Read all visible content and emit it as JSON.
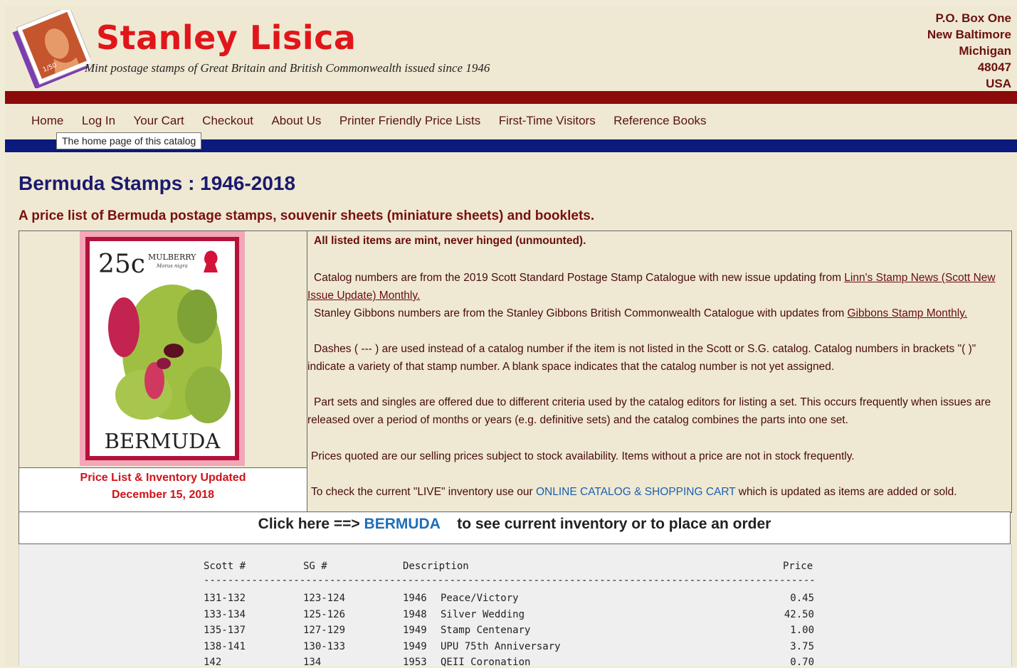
{
  "header": {
    "title": "Stanley Lisica",
    "tagline": "Mint postage stamps of Great Britain and British Commonwealth issued since 1946",
    "address": [
      "P.O. Box One",
      "New Baltimore",
      "Michigan",
      "48047",
      "USA"
    ]
  },
  "nav": {
    "items": [
      "Home",
      "Log In",
      "Your Cart",
      "Checkout",
      "About Us",
      "Printer Friendly Price Lists",
      "First-Time Visitors",
      "Reference Books"
    ],
    "tooltip": "The home page of this catalog"
  },
  "main": {
    "title": "Bermuda Stamps : 1946-2018",
    "subtitle": "A price list of Bermuda postage stamps, souvenir sheets (miniature sheets) and booklets.",
    "stamp": {
      "value": "25c",
      "name": "MULBERRY",
      "latin": "Morus nigra",
      "country": "BERMUDA"
    },
    "updated_line1": "Price List & Inventory Updated",
    "updated_line2": "December 15, 2018",
    "p1": "All listed items are mint, never hinged (unmounted).",
    "p2_text": "Catalog numbers are from the 2019 Scott Standard Postage Stamp Catalogue with new issue updating from ",
    "p2_link": "Linn's Stamp News (Scott New Issue Update) Monthly.",
    "p3_text": "Stanley Gibbons numbers are from the Stanley Gibbons British Commonwealth Catalogue with updates from ",
    "p3_link": "Gibbons Stamp Monthly.",
    "p4": "Dashes ( --- ) are used instead of a catalog number if the item is not listed in the Scott or S.G. catalog.  Catalog numbers in brackets \"( )\" indicate a variety of that stamp number.  A blank space indicates that the catalog number is not yet assigned.",
    "p5": "Part sets and singles are offered due to different criteria used by the catalog editors for listing a set. This occurs frequently when issues are released over a period of months or years  (e.g. definitive sets) and the catalog combines the parts into one set.",
    "p6": "Prices quoted are our selling prices subject to stock availability. Items without a price are not in stock frequently.",
    "p7_pre": "To check the current \"LIVE\" inventory use our ",
    "p7_link": "ONLINE CATALOG & SHOPPING CART",
    "p7_post": " which is updated as items are added or sold.",
    "click_pre": "Click here ==> ",
    "click_link": "BERMUDA",
    "click_post": "to see current inventory or to place an order"
  },
  "price_table": {
    "headers": [
      "Scott #",
      "SG #",
      "Description",
      "Price"
    ],
    "divider": "------------------------------------------------------------------------------------------------------------------------",
    "rows": [
      [
        "131-132",
        "123-124",
        "1946",
        "Peace/Victory",
        "0.45"
      ],
      [
        "133-134",
        "125-126",
        "1948",
        "Silver Wedding",
        "42.50"
      ],
      [
        "135-137",
        "127-129",
        "1949",
        "Stamp Centenary",
        "1.00"
      ],
      [
        "138-141",
        "130-133",
        "1949",
        "UPU 75th Anniversary",
        "3.75"
      ],
      [
        "142",
        "134",
        "1953",
        "QEII Coronation",
        "0.70"
      ]
    ]
  },
  "colors": {
    "red_bar": "#8b0a0a",
    "blue_bar": "#0b1a7c",
    "title_red": "#e0161a"
  }
}
